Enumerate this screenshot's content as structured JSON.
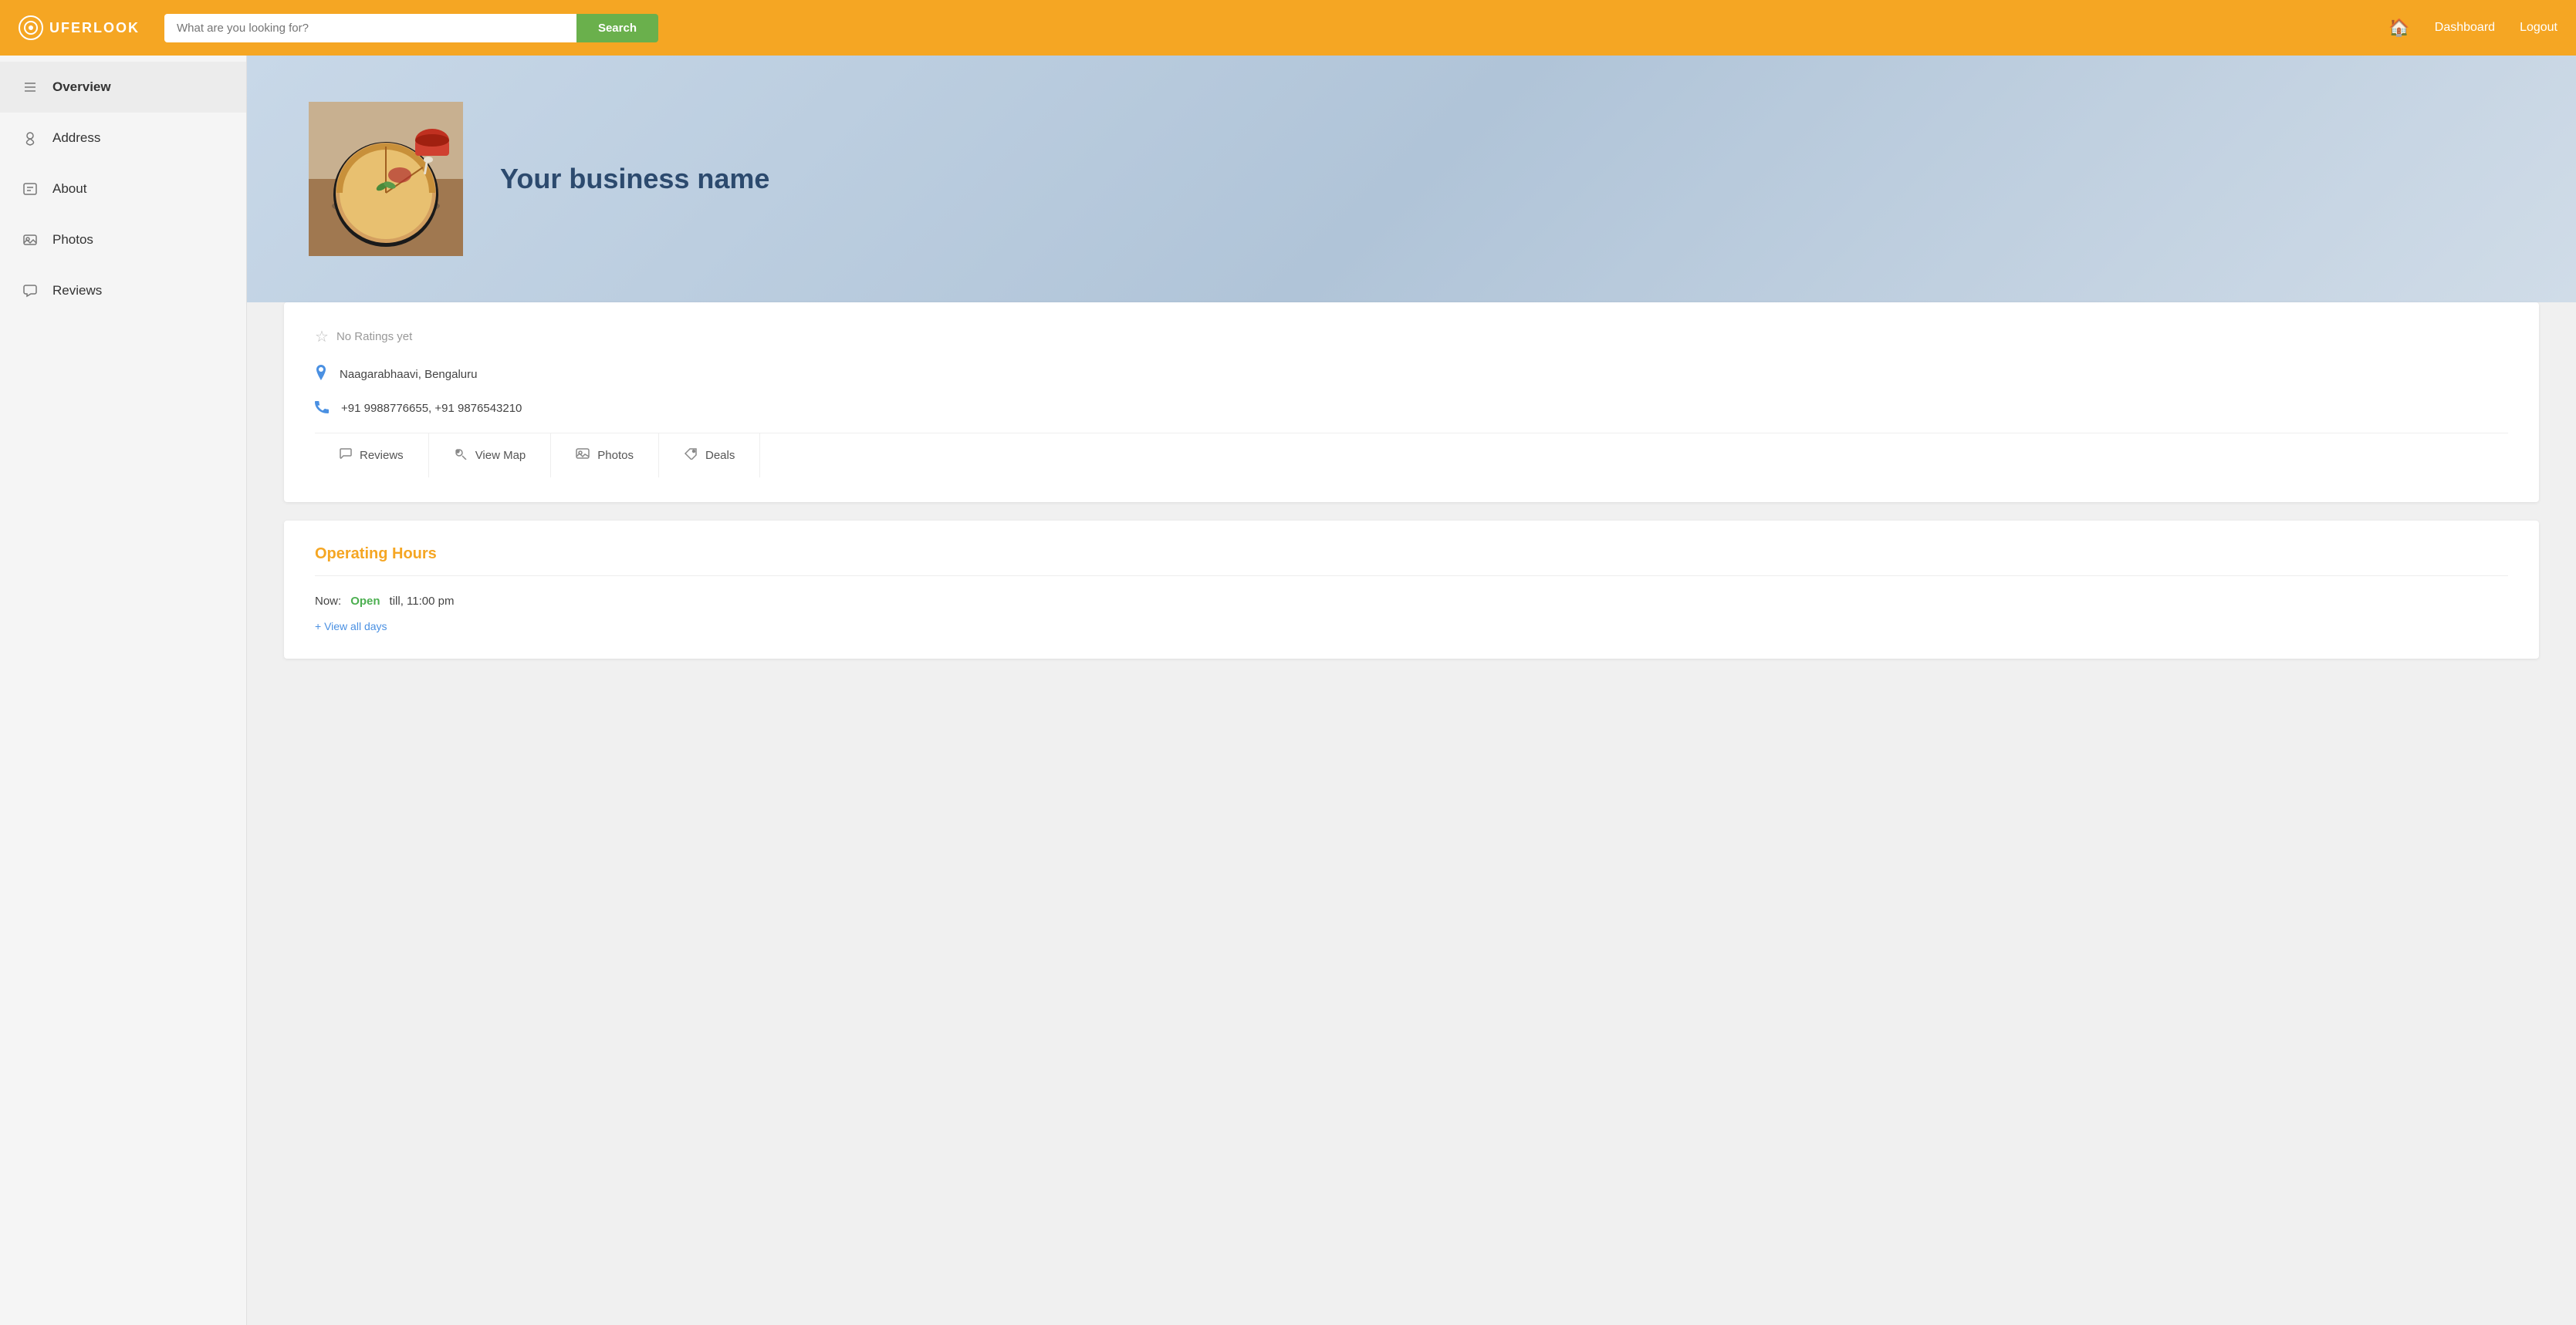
{
  "app": {
    "logo_text": "UFERLOOK",
    "logo_icon": "U"
  },
  "header": {
    "search_placeholder": "What are you looking for?",
    "search_button_label": "Search",
    "home_icon": "🏠",
    "nav_links": [
      {
        "label": "Dashboard"
      },
      {
        "label": "Logout"
      }
    ]
  },
  "sidebar": {
    "items": [
      {
        "id": "overview",
        "label": "Overview",
        "icon": "≡"
      },
      {
        "id": "address",
        "label": "Address",
        "icon": "👤"
      },
      {
        "id": "about",
        "label": "About",
        "icon": "🪪"
      },
      {
        "id": "photos",
        "label": "Photos",
        "icon": "🖼"
      },
      {
        "id": "reviews",
        "label": "Reviews",
        "icon": "💬"
      }
    ]
  },
  "business": {
    "name": "Your business name",
    "photo_emoji": "🥧",
    "ratings_text": "No Ratings yet",
    "address": "Naagarabhaavi, Bengaluru",
    "phone": "+91 9988776655,    +91 9876543210"
  },
  "action_buttons": [
    {
      "label": "Reviews",
      "icon": "✏️"
    },
    {
      "label": "View Map",
      "icon": "👥"
    },
    {
      "label": "Photos",
      "icon": "🖼"
    },
    {
      "label": "Deals",
      "icon": "🏷"
    }
  ],
  "operating_hours": {
    "title": "Operating Hours",
    "now_label": "Now:",
    "status": "Open",
    "till_text": "till, 11:00 pm",
    "view_all_label": "+ View all days"
  }
}
